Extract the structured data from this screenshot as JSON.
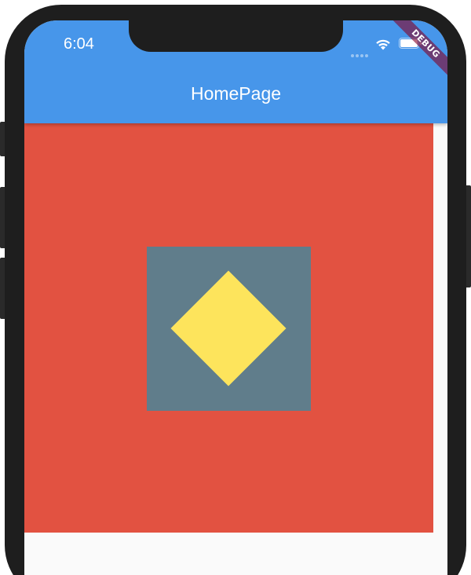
{
  "status_bar": {
    "time": "6:04"
  },
  "appbar": {
    "title": "HomePage",
    "color": "#4796ea"
  },
  "debug_banner": {
    "label": "DEBUG"
  },
  "content": {
    "outer_color": "#e25241",
    "middle_color": "#607d8b",
    "inner_color": "#fde45c",
    "background_color": "#fafafa"
  },
  "icons": {
    "signal": "signal-dots-icon",
    "wifi": "wifi-icon",
    "battery": "battery-icon"
  }
}
